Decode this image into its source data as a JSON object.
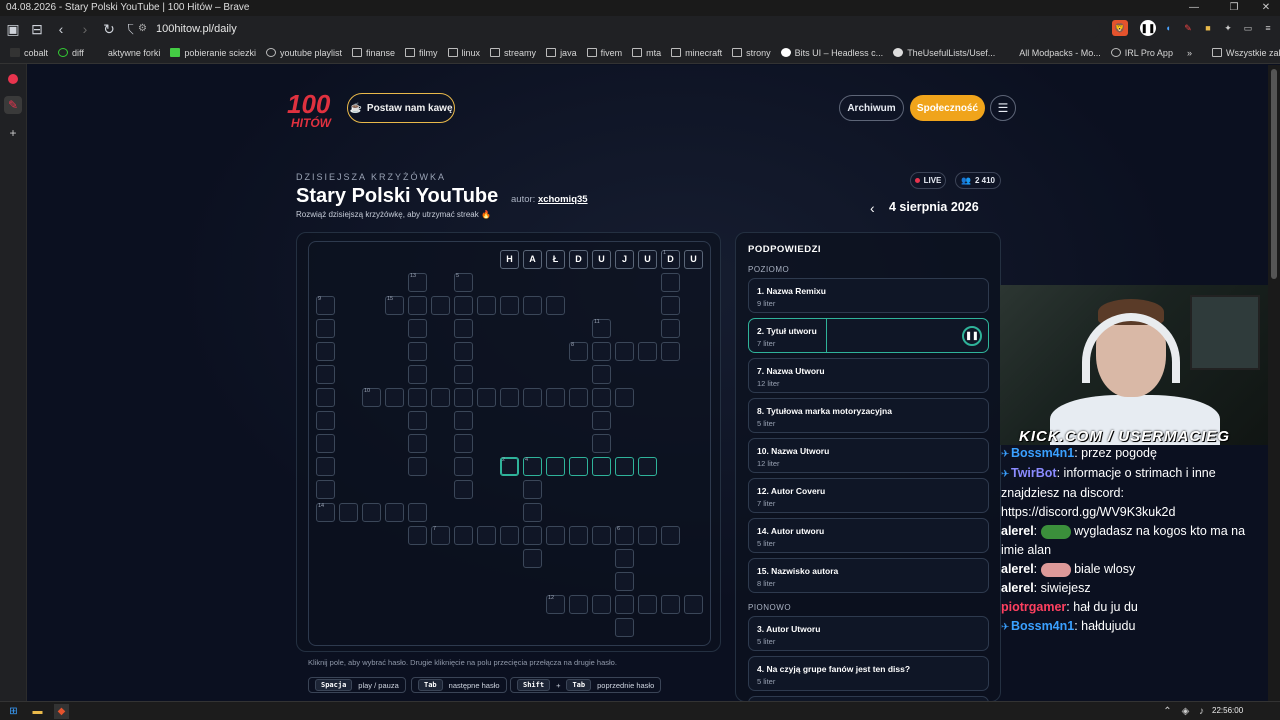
{
  "browser": {
    "window_title": "04.08.2026 - Stary Polski YouTube | 100 Hitów – Brave",
    "url": "100hitow.pl/daily",
    "bookmarks": [
      "cobalt",
      "diff",
      "aktywne forki",
      "pobieranie sciezki",
      "youtube playlist",
      "finanse",
      "filmy",
      "linux",
      "streamy",
      "java",
      "fivem",
      "mta",
      "minecraft",
      "strony",
      "Bits UI – Headless c...",
      "TheUsefulLists/Usef...",
      "All Modpacks - Mo...",
      "IRL Pro App"
    ],
    "bookmarks_more": "»",
    "all_bookmarks": "Wszystkie zakładki"
  },
  "header": {
    "logo_text": "100 HITÓW",
    "coffee_label": "Postaw nam kawę",
    "archive_label": "Archiwum",
    "community_label": "Społeczność"
  },
  "puzzle": {
    "section_label": "DZISIEJSZA KRZYŻÓWKA",
    "title": "Stary Polski YouTube",
    "author_prefix": "autor:",
    "author": "xchomiq35",
    "subtitle": "Rozwiąż dzisiejszą krzyżówkę, aby utrzymać streak 🔥",
    "live_label": "LIVE",
    "players": "2 410",
    "date": "4 sierpnia 2026"
  },
  "grid": {
    "filled_row": [
      "H",
      "A",
      "Ł",
      "D",
      "U",
      "J",
      "U",
      "D",
      "U"
    ],
    "clue_numbers": [
      "1",
      "2",
      "3",
      "4",
      "5",
      "6",
      "7",
      "8",
      "9",
      "10",
      "11",
      "12",
      "13",
      "14",
      "15"
    ]
  },
  "clues": {
    "title": "PODPOWIEDZI",
    "across_label": "POZIOMO",
    "down_label": "PIONOWO",
    "across": [
      {
        "title": "1. Nazwa Remixu",
        "len": "9 liter"
      },
      {
        "title": "2. Tytuł utworu",
        "len": "7 liter"
      },
      {
        "title": "7. Nazwa Utworu",
        "len": "12 liter"
      },
      {
        "title": "8. Tytułowa marka motoryzacyjna",
        "len": "5 liter"
      },
      {
        "title": "10. Nazwa Utworu",
        "len": "12 liter"
      },
      {
        "title": "12. Autor Coveru",
        "len": "7 liter"
      },
      {
        "title": "14. Autor utworu",
        "len": "5 liter"
      },
      {
        "title": "15. Nazwisko autora",
        "len": "8 liter"
      }
    ],
    "down": [
      {
        "title": "3. Autor Utworu",
        "len": "5 liter"
      },
      {
        "title": "4. Na czyją grupe fanów jest ten diss?",
        "len": "5 liter"
      }
    ]
  },
  "help": {
    "line": "Kliknij pole, aby wybrać hasło. Drugie kliknięcie na polu przecięcia przełącza na drugie hasło.",
    "k1_key": "Spacja",
    "k1_text": "play / pauza",
    "k2_key": "Tab",
    "k2_text": "następne hasło",
    "k3_key1": "Shift",
    "k3_plus": "+",
    "k3_key2": "Tab",
    "k3_text": "poprzednie hasło"
  },
  "stream": {
    "overlay": "KICK.COM / USERMACIEG",
    "chat": [
      {
        "user": "Bossm4n1",
        "msg": ": przez pogodę",
        "color": "#3aa0ff",
        "icon": true
      },
      {
        "user": "TwirBot",
        "msg": ": informacje o strimach i inne znajdziesz na discord: https://discord.gg/WV9K3kuk2d",
        "color": "#8b8bff",
        "icon": true
      },
      {
        "user": "alerel",
        "msg": ": wygladasz na kogos kto ma na imie alan",
        "color": "#ffffff",
        "icon": false,
        "emote": "#3b8f3b"
      },
      {
        "user": "alerel",
        "msg": " biale wlosy",
        "color": "#ffffff",
        "icon": false,
        "emote": "#d99"
      },
      {
        "user": "alerel",
        "msg": ": siwiejesz",
        "color": "#ffffff",
        "icon": false
      },
      {
        "user": "piotrgamer",
        "msg": ": hał du ju du",
        "color": "#ff4060",
        "icon": false
      },
      {
        "user": "Bossm4n1",
        "msg": ": hałdujudu",
        "color": "#3aa0ff",
        "icon": true
      }
    ]
  },
  "taskbar": {
    "time": "22:56:00"
  }
}
